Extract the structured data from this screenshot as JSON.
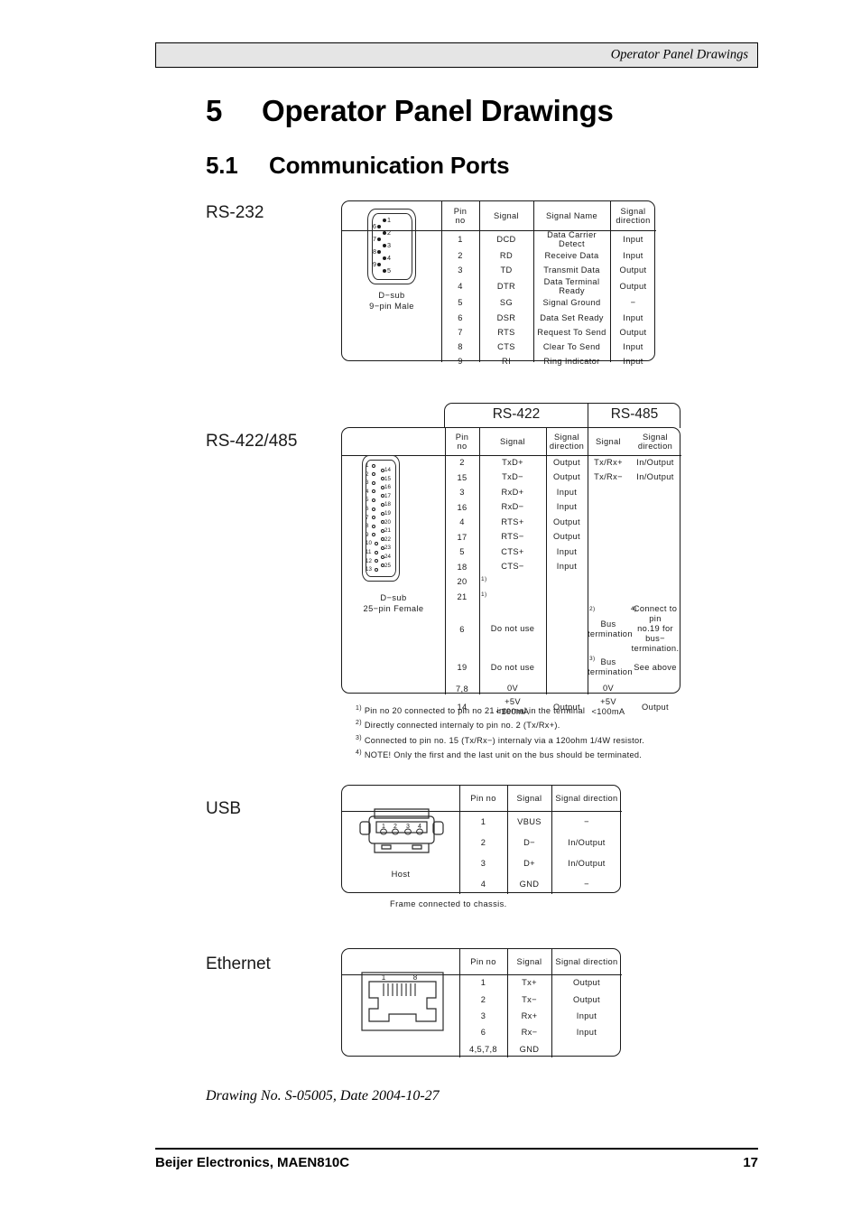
{
  "header": {
    "running_title": "Operator Panel Drawings"
  },
  "headings": {
    "h1_number": "5",
    "h1_title": "Operator Panel Drawings",
    "h2_number": "5.1",
    "h2_title": "Communication Ports"
  },
  "sections": {
    "rs232_label": "RS-232",
    "rs422_label": "RS-422/485",
    "usb_label": "USB",
    "ethernet_label": "Ethernet"
  },
  "rs232": {
    "connector": {
      "caption_line1": "D−sub",
      "caption_line2": "9−pin Male",
      "right_pins": [
        "1",
        "2",
        "3",
        "4",
        "5"
      ],
      "left_pins": [
        "6",
        "7",
        "8",
        "9"
      ]
    },
    "columns": [
      "Pin\nno",
      "Signal",
      "Signal Name",
      "Signal direction"
    ],
    "header": {
      "pin_no": "Pin no",
      "signal": "Signal",
      "signal_name": "Signal Name",
      "signal_direction": "Signal direction"
    },
    "rows": [
      {
        "pin": "1",
        "signal": "DCD",
        "name": "Data Carrier Detect",
        "dir": "Input"
      },
      {
        "pin": "2",
        "signal": "RD",
        "name": "Receive Data",
        "dir": "Input"
      },
      {
        "pin": "3",
        "signal": "TD",
        "name": "Transmit Data",
        "dir": "Output"
      },
      {
        "pin": "4",
        "signal": "DTR",
        "name": "Data Terminal Ready",
        "dir": "Output"
      },
      {
        "pin": "5",
        "signal": "SG",
        "name": "Signal Ground",
        "dir": "−"
      },
      {
        "pin": "6",
        "signal": "DSR",
        "name": "Data Set Ready",
        "dir": "Input"
      },
      {
        "pin": "7",
        "signal": "RTS",
        "name": "Request To Send",
        "dir": "Output"
      },
      {
        "pin": "8",
        "signal": "CTS",
        "name": "Clear To Send",
        "dir": "Input"
      },
      {
        "pin": "9",
        "signal": "RI",
        "name": "Ring Indicator",
        "dir": "Input"
      }
    ]
  },
  "rs422": {
    "group_headers": {
      "left": "RS-422",
      "right": "RS-485"
    },
    "connector": {
      "caption_line1": "D−sub",
      "caption_line2": "25−pin Female",
      "left_pins": [
        "1",
        "2",
        "3",
        "4",
        "5",
        "6",
        "7",
        "8",
        "9",
        "10",
        "11",
        "12",
        "13"
      ],
      "right_pins": [
        "14",
        "15",
        "16",
        "17",
        "18",
        "19",
        "20",
        "21",
        "22",
        "23",
        "24",
        "25"
      ]
    },
    "header": {
      "pin_no": "Pin no",
      "s422_signal": "Signal",
      "s422_dir": "Signal direction",
      "s485_signal": "Signal",
      "s485_dir": "Signal direction"
    },
    "rows": [
      {
        "pin": "2",
        "s422_signal": "TxD+",
        "s422_dir": "Output",
        "s485_signal": "Tx/Rx+",
        "s485_dir": "In/Output",
        "mark422": "",
        "mark485": "",
        "mark485dir": ""
      },
      {
        "pin": "15",
        "s422_signal": "TxD−",
        "s422_dir": "Output",
        "s485_signal": "Tx/Rx−",
        "s485_dir": "In/Output",
        "mark422": "",
        "mark485": "",
        "mark485dir": ""
      },
      {
        "pin": "3",
        "s422_signal": "RxD+",
        "s422_dir": "Input",
        "s485_signal": "",
        "s485_dir": "",
        "mark422": "",
        "mark485": "",
        "mark485dir": ""
      },
      {
        "pin": "16",
        "s422_signal": "RxD−",
        "s422_dir": "Input",
        "s485_signal": "",
        "s485_dir": "",
        "mark422": "",
        "mark485": "",
        "mark485dir": ""
      },
      {
        "pin": "4",
        "s422_signal": "RTS+",
        "s422_dir": "Output",
        "s485_signal": "",
        "s485_dir": "",
        "mark422": "",
        "mark485": "",
        "mark485dir": ""
      },
      {
        "pin": "17",
        "s422_signal": "RTS−",
        "s422_dir": "Output",
        "s485_signal": "",
        "s485_dir": "",
        "mark422": "",
        "mark485": "",
        "mark485dir": ""
      },
      {
        "pin": "5",
        "s422_signal": "CTS+",
        "s422_dir": "Input",
        "s485_signal": "",
        "s485_dir": "",
        "mark422": "",
        "mark485": "",
        "mark485dir": ""
      },
      {
        "pin": "18",
        "s422_signal": "CTS−",
        "s422_dir": "Input",
        "s485_signal": "",
        "s485_dir": "",
        "mark422": "",
        "mark485": "",
        "mark485dir": ""
      },
      {
        "pin": "20",
        "s422_signal": "",
        "s422_dir": "",
        "s485_signal": "",
        "s485_dir": "",
        "mark422": "1)",
        "mark485": "",
        "mark485dir": ""
      },
      {
        "pin": "21",
        "s422_signal": "",
        "s422_dir": "",
        "s485_signal": "",
        "s485_dir": "",
        "mark422": "1)",
        "mark485": "",
        "mark485dir": ""
      },
      {
        "pin": "6",
        "s422_signal": "Do not use",
        "s422_dir": "",
        "s485_signal": "Bus\ntermination",
        "s485_dir": "Connect to pin\nno.19 for bus−\ntermination.",
        "mark422": "",
        "mark485": "2)",
        "mark485dir": "4)"
      },
      {
        "pin": "19",
        "s422_signal": "Do not use",
        "s422_dir": "",
        "s485_signal": "Bus\ntermination",
        "s485_dir": "See above",
        "mark422": "",
        "mark485": "3)",
        "mark485dir": ""
      },
      {
        "pin": "7,8",
        "s422_signal": "0V",
        "s422_dir": "",
        "s485_signal": "0V",
        "s485_dir": "",
        "mark422": "",
        "mark485": "",
        "mark485dir": ""
      },
      {
        "pin": "14",
        "s422_signal": "+5V\n<100mA",
        "s422_dir": "Output",
        "s485_signal": "+5V\n<100mA",
        "s485_dir": "Output",
        "mark422": "",
        "mark485": "",
        "mark485dir": ""
      }
    ],
    "footnotes": [
      {
        "mark": "1)",
        "text": "Pin no 20 connected to pin no 21 internal in the terminal"
      },
      {
        "mark": "2)",
        "text": "Directly connected internaly to pin no. 2 (Tx/Rx+)."
      },
      {
        "mark": "3)",
        "text": "Connected to pin no. 15 (Tx/Rx−) internaly via a 120ohm 1/4W resistor."
      },
      {
        "mark": "4)",
        "text": "NOTE! Only the first and the last unit on the bus should be terminated."
      }
    ]
  },
  "usb": {
    "connector": {
      "caption": "Host",
      "pin_labels": [
        "1",
        "2",
        "3",
        "4"
      ]
    },
    "header": {
      "pin_no": "Pin no",
      "signal": "Signal",
      "signal_direction": "Signal direction"
    },
    "rows": [
      {
        "pin": "1",
        "signal": "VBUS",
        "dir": "−"
      },
      {
        "pin": "2",
        "signal": "D−",
        "dir": "In/Output"
      },
      {
        "pin": "3",
        "signal": "D+",
        "dir": "In/Output"
      },
      {
        "pin": "4",
        "signal": "GND",
        "dir": "−"
      }
    ],
    "note": "Frame connected to chassis."
  },
  "ethernet": {
    "connector": {
      "pin_first": "1",
      "pin_last": "8"
    },
    "header": {
      "pin_no": "Pin no",
      "signal": "Signal",
      "signal_direction": "Signal direction"
    },
    "rows": [
      {
        "pin": "1",
        "signal": "Tx+",
        "dir": "Output"
      },
      {
        "pin": "2",
        "signal": "Tx−",
        "dir": "Output"
      },
      {
        "pin": "3",
        "signal": "Rx+",
        "dir": "Input"
      },
      {
        "pin": "6",
        "signal": "Rx−",
        "dir": "Input"
      },
      {
        "pin": "4,5,7,8",
        "signal": "GND",
        "dir": ""
      }
    ]
  },
  "caption": {
    "drawing": "Drawing No. S-05005, Date 2004-10-27"
  },
  "footer": {
    "left": "Beijer Electronics, MAEN810C",
    "page": "17"
  }
}
